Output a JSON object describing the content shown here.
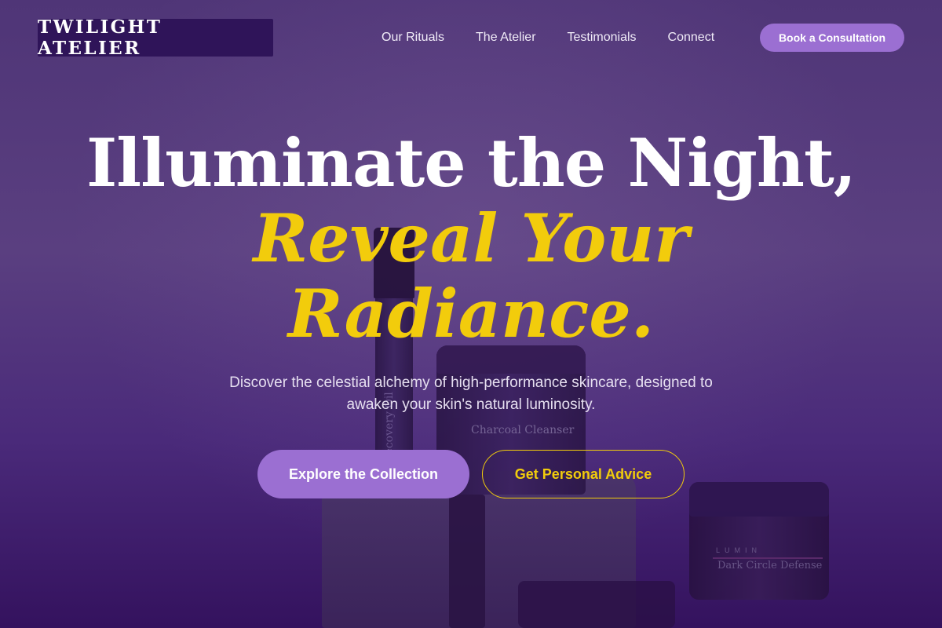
{
  "header": {
    "logo": "TWILIGHT ATELIER",
    "nav": [
      {
        "label": "Our Rituals"
      },
      {
        "label": "The Atelier"
      },
      {
        "label": "Testimonials"
      },
      {
        "label": "Connect"
      }
    ],
    "cta_label": "Book a Consultation"
  },
  "hero": {
    "headline_line1": "Illuminate the Night,",
    "headline_line2": "Reveal Your Radiance.",
    "subtext": "Discover the celestial alchemy of high-performance skincare, designed to awaken your skin's natural luminosity.",
    "primary_button": "Explore the Collection",
    "secondary_button": "Get Personal Advice"
  },
  "background_products": {
    "tall_bottle_label": "Recovery Oil",
    "big_jar_label": "Charcoal Cleanser",
    "small_jar_brand": "LUMIN",
    "small_jar_label": "Dark Circle Defense"
  },
  "colors": {
    "accent_purple": "#9b6fd2",
    "accent_gold": "#f2cc0c",
    "logo_bg": "#2f1459"
  }
}
